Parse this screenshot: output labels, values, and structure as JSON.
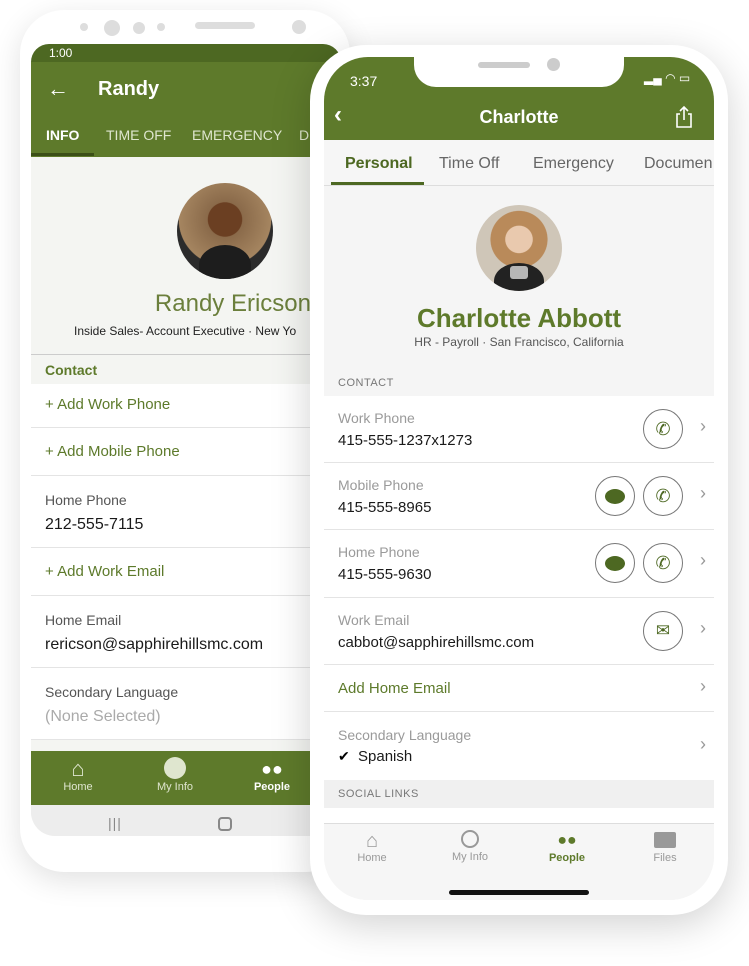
{
  "colors": {
    "brand_green": "#5e7a2b",
    "status_green": "#4d6822"
  },
  "android": {
    "status_time": "1:00",
    "title": "Randy",
    "tabs": [
      {
        "label": "INFO",
        "active": true
      },
      {
        "label": "TIME OFF"
      },
      {
        "label": "EMERGENCY"
      },
      {
        "label": "D"
      }
    ],
    "profile": {
      "name": "Randy Ericson",
      "subtitle": "Inside Sales- Account Executive · New Yo"
    },
    "section": "Contact",
    "rows": [
      {
        "add": "+ Add Work Phone"
      },
      {
        "add": "+ Add Mobile Phone"
      },
      {
        "label": "Home Phone",
        "value": "212-555-7115"
      },
      {
        "add": "+ Add Work Email"
      },
      {
        "label": "Home Email",
        "value": "rericson@sapphirehillsmc.com"
      },
      {
        "label": "Secondary Language",
        "value": "(None Selected)"
      }
    ],
    "nav": [
      {
        "label": "Home",
        "icon": "home-icon"
      },
      {
        "label": "My Info",
        "icon": "user-icon"
      },
      {
        "label": "People",
        "icon": "people-icon",
        "active": true
      }
    ]
  },
  "ios": {
    "status_time": "3:37",
    "title": "Charlotte",
    "tabs": [
      {
        "label": "Personal",
        "active": true
      },
      {
        "label": "Time Off"
      },
      {
        "label": "Emergency"
      },
      {
        "label": "Documen"
      }
    ],
    "profile": {
      "name": "Charlotte Abbott",
      "subtitle": "HR - Payroll · San Francisco, California"
    },
    "section_contact": "CONTACT",
    "rows": [
      {
        "label": "Work Phone",
        "value": "415-555-1237x1273",
        "actions": [
          "phone-icon"
        ]
      },
      {
        "label": "Mobile Phone",
        "value": "415-555-8965",
        "actions": [
          "message-icon",
          "phone-icon"
        ]
      },
      {
        "label": "Home Phone",
        "value": "415-555-9630",
        "actions": [
          "message-icon",
          "phone-icon"
        ]
      },
      {
        "label": "Work Email",
        "value": "cabbot@sapphirehillsmc.com",
        "actions": [
          "mail-icon"
        ]
      }
    ],
    "add_home_email": "Add Home Email",
    "secondary_language": {
      "label": "Secondary Language",
      "value": "Spanish"
    },
    "section_social": "SOCIAL LINKS",
    "nav": [
      {
        "label": "Home",
        "icon": "home-icon"
      },
      {
        "label": "My Info",
        "icon": "user-icon"
      },
      {
        "label": "People",
        "icon": "people-icon",
        "active": true
      },
      {
        "label": "Files",
        "icon": "folder-icon"
      }
    ]
  }
}
